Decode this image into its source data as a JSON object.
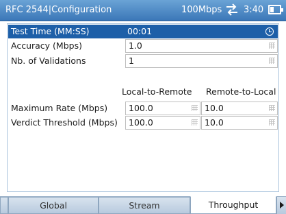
{
  "header": {
    "title": "RFC 2544|Configuration",
    "link_speed": "100Mbps",
    "link_icon": "link-arrows-icon",
    "time": "3:40",
    "battery_icon": "battery-icon"
  },
  "colors": {
    "title_bar": "#3b77b8",
    "selected_row": "#1d5fa8"
  },
  "fields": {
    "test_time": {
      "label": "Test Time (MM:SS)",
      "value": "00:01",
      "icon": "clock-icon"
    },
    "accuracy": {
      "label": "Accuracy (Mbps)",
      "value": "1.0"
    },
    "validations": {
      "label": "Nb. of Validations",
      "value": "1"
    }
  },
  "columns": {
    "local": "Local-to-Remote",
    "remote": "Remote-to-Local"
  },
  "rates": {
    "max_rate": {
      "label": "Maximum Rate (Mbps)",
      "local": "100.0",
      "remote": "10.0"
    },
    "verdict": {
      "label": "Verdict Threshold (Mbps)",
      "local": "100.0",
      "remote": "10.0"
    }
  },
  "tabs": {
    "first_partial": "",
    "global": "Global",
    "stream": "Stream",
    "throughput": "Throughput",
    "active": "Throughput"
  }
}
